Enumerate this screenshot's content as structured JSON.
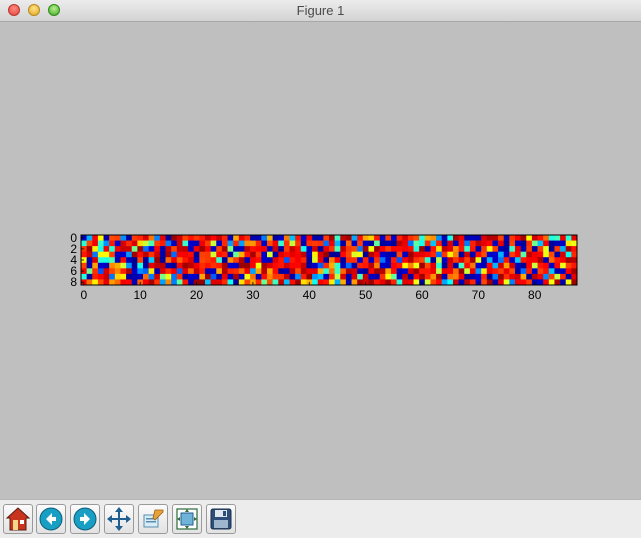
{
  "window": {
    "title": "Figure 1"
  },
  "toolbar": {
    "buttons": [
      {
        "name": "home-button",
        "icon": "home-icon"
      },
      {
        "name": "back-button",
        "icon": "back-arrow-icon"
      },
      {
        "name": "forward-button",
        "icon": "forward-arrow-icon"
      },
      {
        "name": "pan-button",
        "icon": "move-arrows-icon"
      },
      {
        "name": "zoom-button",
        "icon": "zoom-rect-icon"
      },
      {
        "name": "configure-subplots-button",
        "icon": "subplots-icon"
      },
      {
        "name": "save-button",
        "icon": "floppy-disk-icon"
      }
    ]
  },
  "chart_data": {
    "type": "heatmap",
    "rows": 9,
    "cols": 88,
    "colormap": "jet",
    "xticks": [
      "0",
      "10",
      "20",
      "30",
      "40",
      "50",
      "60",
      "70",
      "80"
    ],
    "yticks": [
      "0",
      "2",
      "4",
      "6",
      "8"
    ],
    "xlim": [
      -0.5,
      87.5
    ],
    "ylim": [
      8.5,
      -0.5
    ],
    "title": "",
    "xlabel": "",
    "ylabel": ""
  }
}
